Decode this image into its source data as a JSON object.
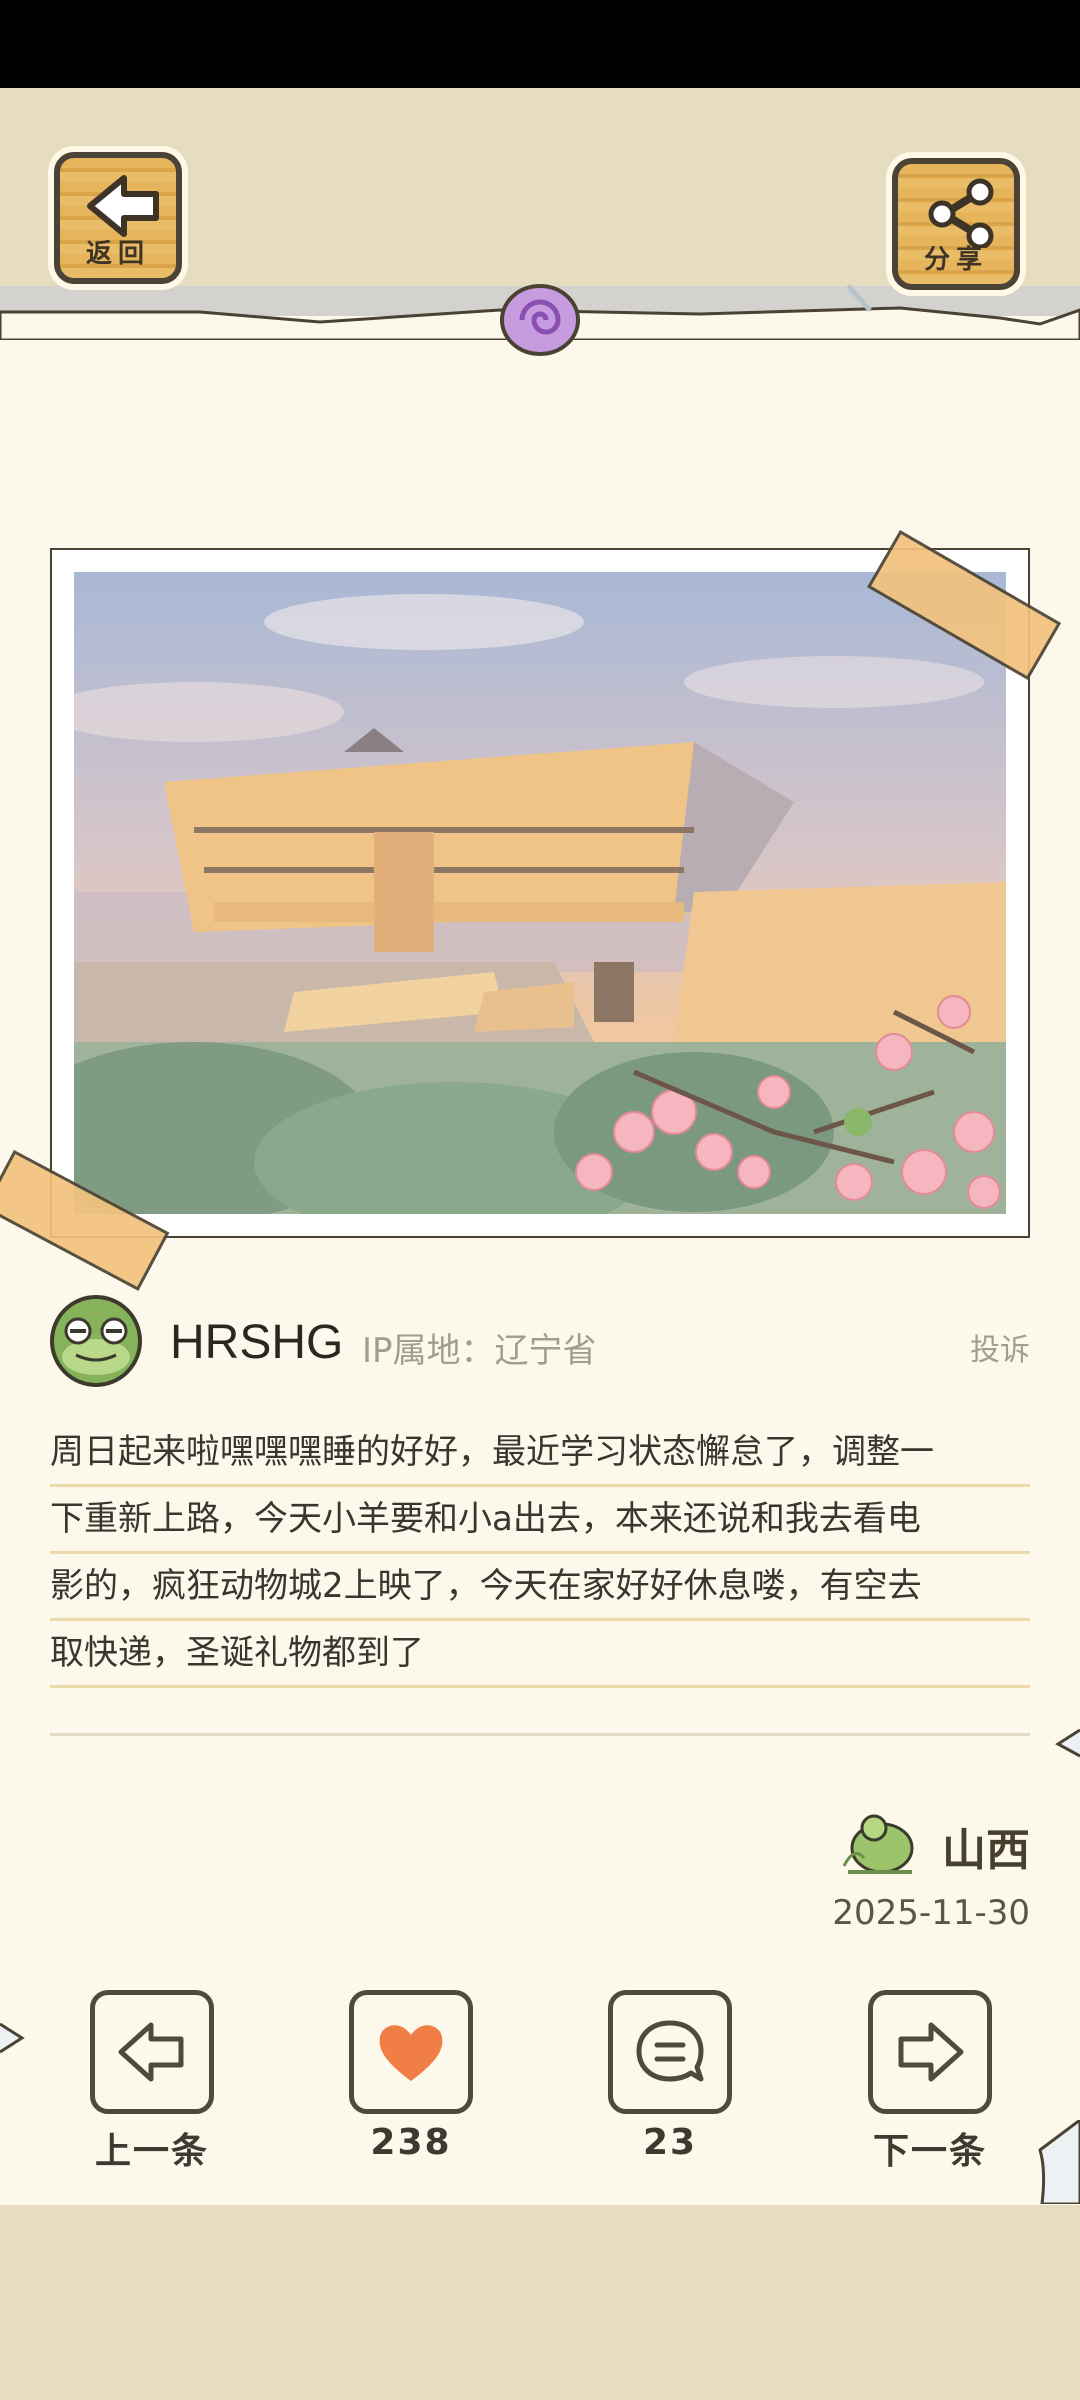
{
  "header": {
    "back_label": "返回",
    "share_label": "分享"
  },
  "post": {
    "username": "HRSHG",
    "ip_location": "IP属地：辽宁省",
    "report_label": "投诉",
    "lines": [
      "周日起来啦嘿嘿嘿睡的好好，最近学习状态懈怠了，调整一",
      "下重新上路，今天小羊要和小a出去，本来还说和我去看电",
      "影的，疯狂动物城2上映了，今天在家好好休息喽，有空去",
      "取快递，圣诞礼物都到了"
    ],
    "location": "山西",
    "date": "2025-11-30"
  },
  "actions": {
    "prev_label": "上一条",
    "like_count": "238",
    "comment_count": "23",
    "next_label": "下一条"
  },
  "colors": {
    "paper": "#fdf8ec",
    "band": "#e6dcbf",
    "wood": "#e6b45a",
    "tape": "#f3c27e",
    "heart": "#f07e45"
  }
}
